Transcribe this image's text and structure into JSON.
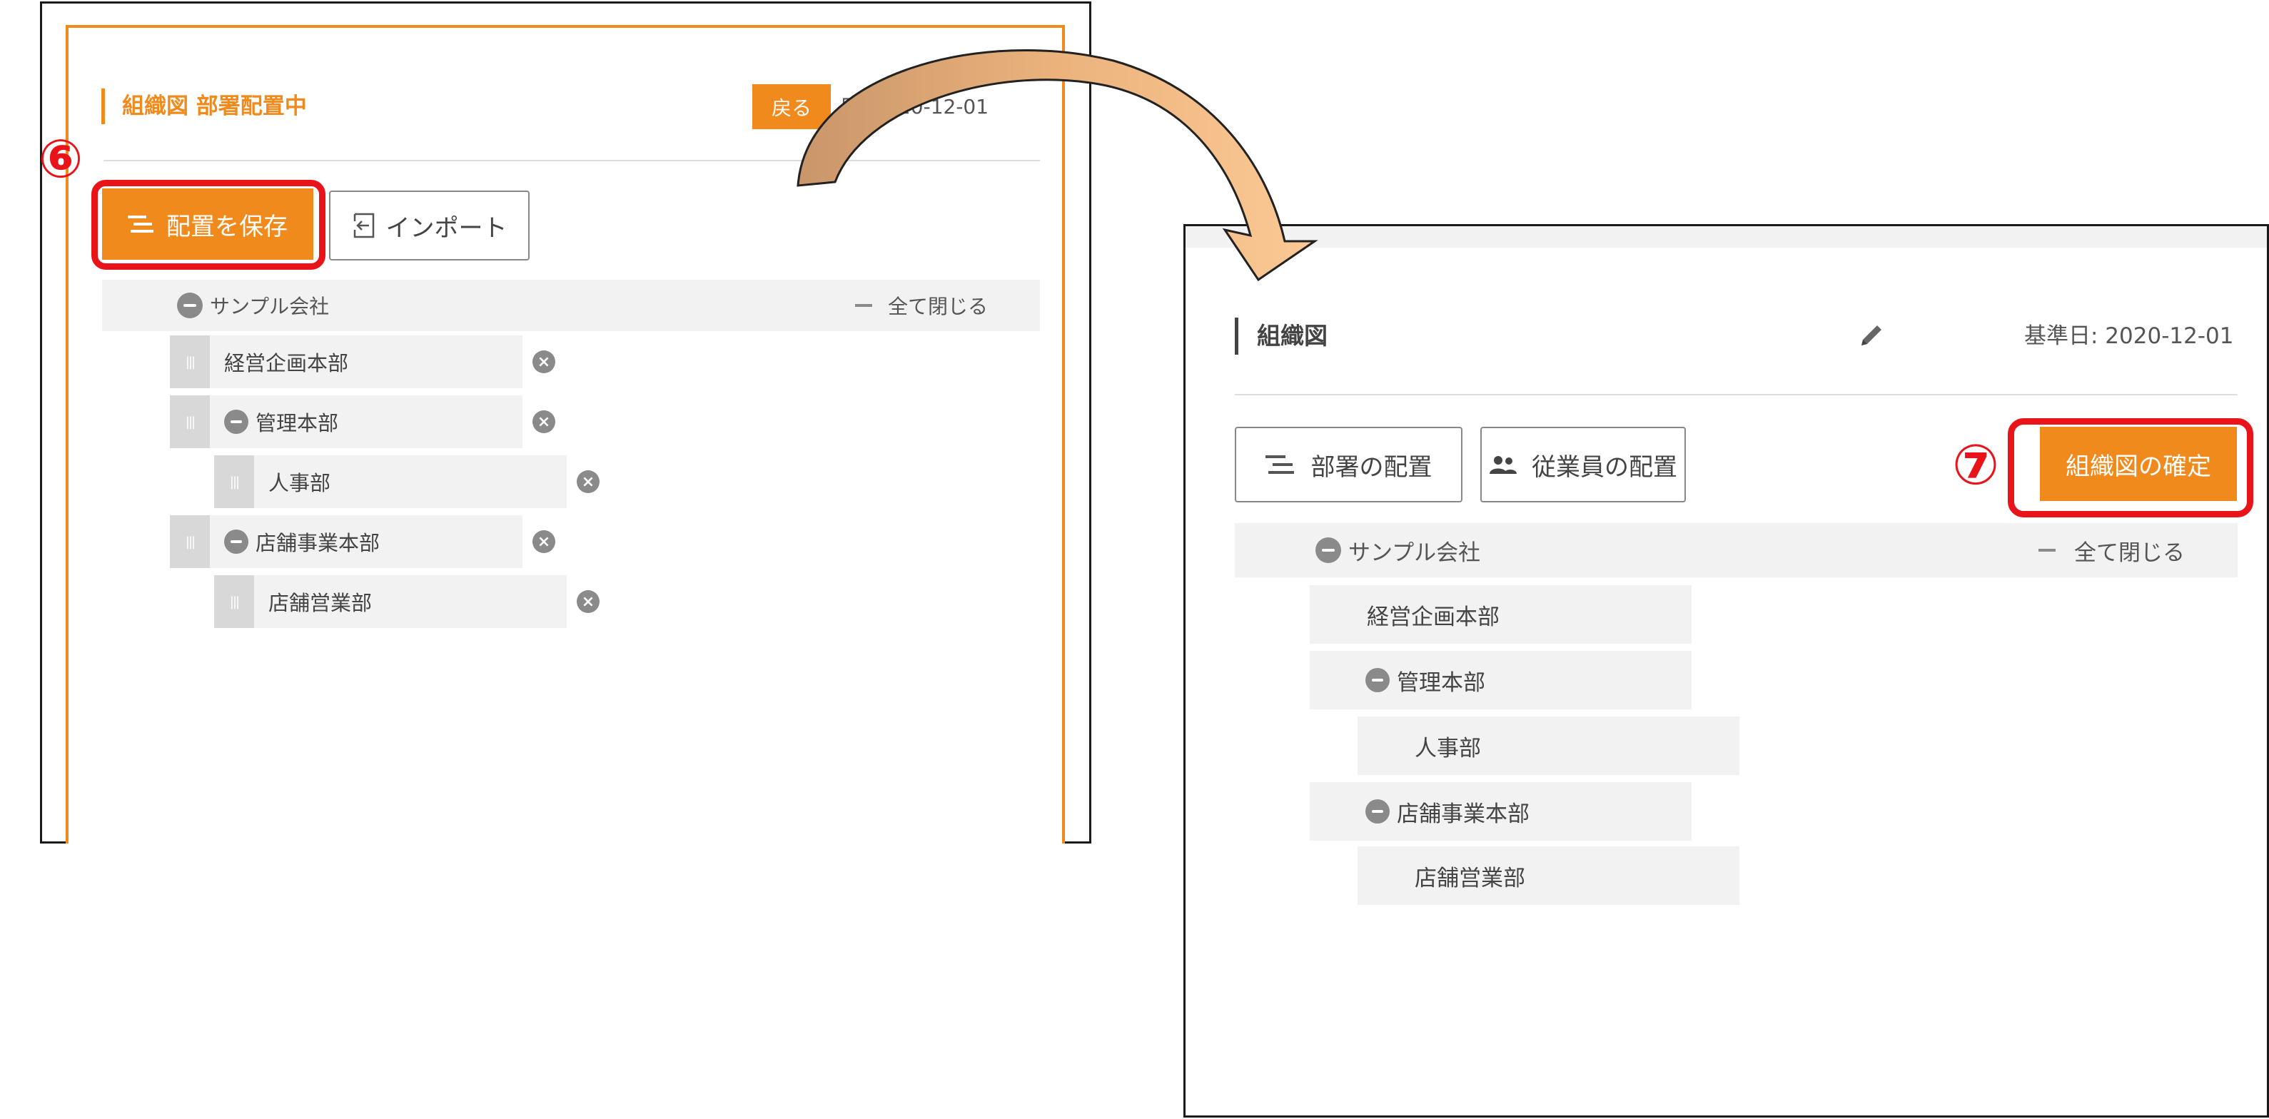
{
  "left_panel": {
    "title": "組織図 部署配置中",
    "back_label": "戻る",
    "date_text": "日: 2020-12-01",
    "step_marker": "⑥",
    "save_label": "配置を保存",
    "import_label": "インポート",
    "root_label": "サンプル会社",
    "collapse_all_label": "全て閉じる",
    "nodes": [
      {
        "label": "経営企画本部"
      },
      {
        "label": "管理本部"
      },
      {
        "label": "人事部"
      },
      {
        "label": "店舗事業本部"
      },
      {
        "label": "店舗営業部"
      }
    ]
  },
  "right_panel": {
    "title": "組織図",
    "date_text": "基準日: 2020-12-01",
    "dept_assign_label": "部署の配置",
    "employee_assign_label": "従業員の配置",
    "step_marker": "⑦",
    "confirm_label": "組織図の確定",
    "root_label": "サンプル会社",
    "collapse_all_label": "全て閉じる",
    "nodes": [
      {
        "label": "経営企画本部"
      },
      {
        "label": "管理本部"
      },
      {
        "label": "人事部"
      },
      {
        "label": "店舗事業本部"
      },
      {
        "label": "店舗営業部"
      }
    ]
  },
  "colors": {
    "accent": "#f08a1c",
    "highlight": "#e8141a",
    "arrow_fill": "#f5c08a",
    "arrow_fill_dark": "#c9966a"
  }
}
